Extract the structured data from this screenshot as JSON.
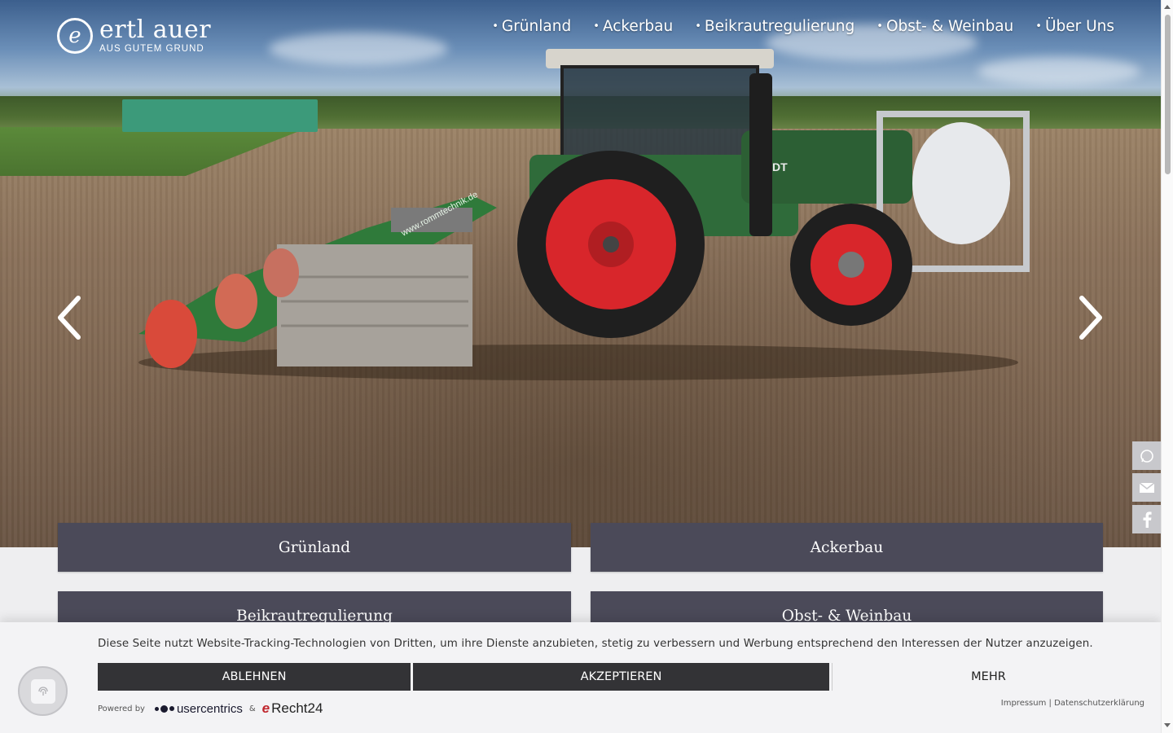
{
  "brand": {
    "name": "ertl auer",
    "tagline": "AUS GUTEM GRUND",
    "mark": "e"
  },
  "nav": {
    "items": [
      "Grünland",
      "Ackerbau",
      "Beikrautregulierung",
      "Obst- & Weinbau",
      "Über Uns"
    ]
  },
  "hero": {
    "prev_icon": "chevron-left-icon",
    "next_icon": "chevron-right-icon",
    "implement_brand": "www.rommtechnik.de",
    "tractor_brand": "FENDT"
  },
  "social": {
    "icons": [
      "whatsapp-icon",
      "envelope-icon",
      "facebook-icon"
    ]
  },
  "tiles": [
    "Grünland",
    "Ackerbau",
    "Beikrautregulierung",
    "Obst- & Weinbau"
  ],
  "cookie": {
    "text": "Diese Seite nutzt Website-Tracking-Technologien von Dritten, um ihre Dienste anzubieten, stetig zu verbessern und Werbung entsprechend den Interessen der Nutzer anzuzeigen.",
    "deny_label": "ABLEHNEN",
    "accept_label": "AKZEPTIEREN",
    "more_label": "MEHR",
    "powered_by": "Powered by",
    "usercentrics": "usercentrics",
    "ampersand": "&",
    "erecht_e": "e",
    "erecht_rest": "Recht24",
    "impressum": "Impressum",
    "separator": "|",
    "datenschutz": "Datenschutzerklärung"
  },
  "colors": {
    "tile_bg": "#4b4a59",
    "button_dark": "#333336",
    "banner_bg": "#f3f3f5",
    "wheel_red": "#d8262b",
    "tractor_green": "#2f6b3a"
  }
}
